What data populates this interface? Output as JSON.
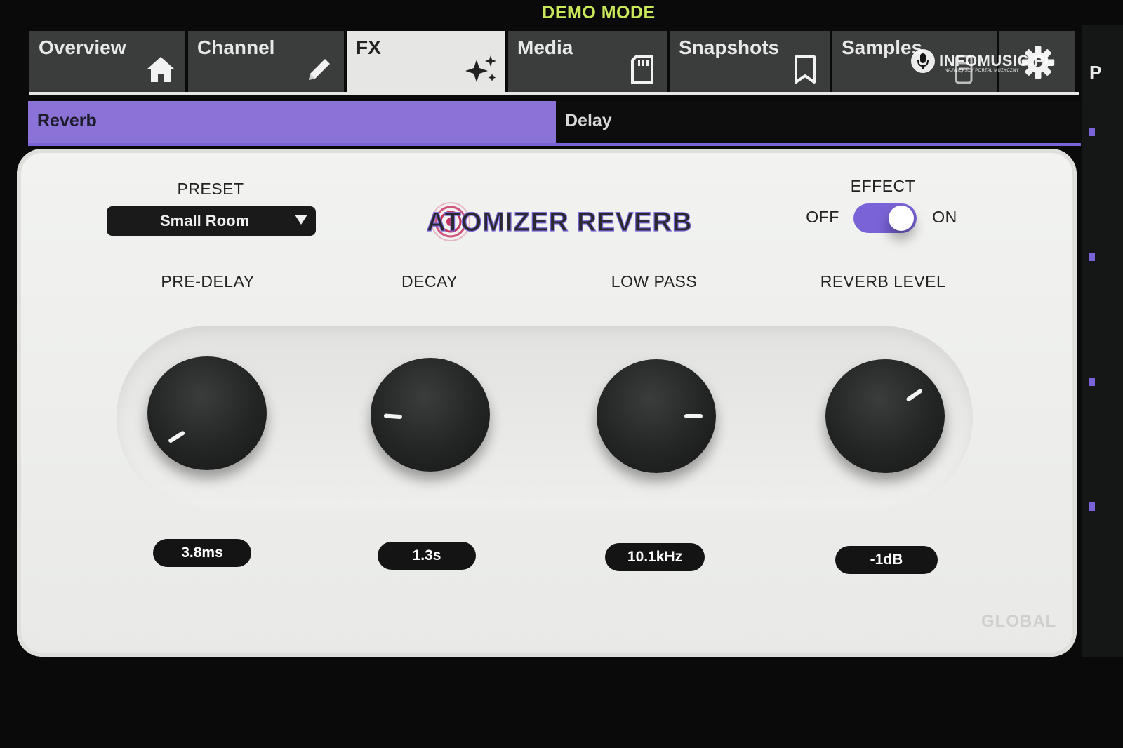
{
  "header": {
    "mode_label": "DEMO MODE"
  },
  "tabs": [
    {
      "label": "Overview",
      "icon": "home-icon"
    },
    {
      "label": "Channel",
      "icon": "pencil-icon"
    },
    {
      "label": "FX",
      "icon": "sparkles-icon",
      "active": true
    },
    {
      "label": "Media",
      "icon": "sd-card-icon"
    },
    {
      "label": "Snapshots",
      "icon": "bookmark-icon"
    },
    {
      "label": "Samples",
      "icon": "sample-icon"
    },
    {
      "label": "",
      "icon": "gear-icon"
    }
  ],
  "watermark": {
    "brand": "INFOMUSIC.PL",
    "tagline": "NAJWIĘKSZY PORTAL MUZYCZNY"
  },
  "right_strip": {
    "letter": "P"
  },
  "subtabs": [
    {
      "label": "Reverb",
      "active": true
    },
    {
      "label": "Delay",
      "active": false
    }
  ],
  "effect_panel": {
    "preset": {
      "label": "PRESET",
      "value": "Small Room"
    },
    "title": "ATOMIZER REVERB",
    "effect": {
      "label": "EFFECT",
      "off_label": "OFF",
      "on_label": "ON",
      "state": "on"
    },
    "knobs": [
      {
        "label": "PRE-DELAY",
        "value": "3.8ms",
        "rotation_deg": -32
      },
      {
        "label": "DECAY",
        "value": "1.3s",
        "rotation_deg": 4
      },
      {
        "label": "LOW PASS",
        "value": "10.1kHz",
        "rotation_deg": 180
      },
      {
        "label": "REVERB LEVEL",
        "value": "-1dB",
        "rotation_deg": 145
      }
    ],
    "footer_label": "GLOBAL"
  },
  "colors": {
    "accent": "#7a63d6",
    "demo_mode": "#c9e85a",
    "panel": "#eceee9",
    "knob": "#232524"
  }
}
